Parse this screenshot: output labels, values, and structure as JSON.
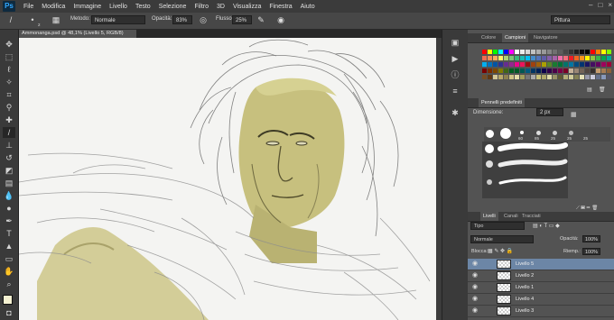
{
  "app": {
    "logo": "Ps"
  },
  "menubar": {
    "items": [
      "File",
      "Modifica",
      "Immagine",
      "Livello",
      "Testo",
      "Selezione",
      "Filtro",
      "3D",
      "Visualizza",
      "Finestra",
      "Aiuto"
    ],
    "window_controls": [
      "–",
      "□",
      "×"
    ]
  },
  "options": {
    "metodo_label": "Metodo:",
    "metodo_value": "Normale",
    "opacita_label": "Opacità:",
    "opacita_value": "83%",
    "flusso_label": "Flusso:",
    "flusso_value": "25%",
    "brush_size": "2",
    "workspace": "Pittura"
  },
  "document": {
    "tab_title": "Ammonanga.psd @ 48,1% (Livello 5, RGB/8)"
  },
  "panels": {
    "color_tabs": [
      "Colore",
      "Campioni",
      "Navigatore"
    ],
    "color_active_index": 1,
    "brush_presets_tab": "Pennelli predefiniti",
    "dimensione_label": "Dimensione:",
    "dimensione_value": "2 px",
    "brush_sizes": [
      "60",
      "85",
      "25",
      "25",
      "25"
    ],
    "layer_tabs": [
      "Livelli",
      "Canali",
      "Tracciati"
    ],
    "layer_filter": "Tipo",
    "blend_mode": "Normale",
    "opacita_label": "Opacità:",
    "opacita_value": "100%",
    "blocca_label": "Blocca:",
    "riemp_label": "Riemp.:",
    "riemp_value": "100%",
    "layers": [
      "Livello 5",
      "Livello 2",
      "Livello 1",
      "Livello 4",
      "Livello 3"
    ],
    "selected_layer_index": 0
  },
  "colors": {
    "accent_selected": "#6c86a6",
    "skin_tone": "#c9c27a"
  }
}
